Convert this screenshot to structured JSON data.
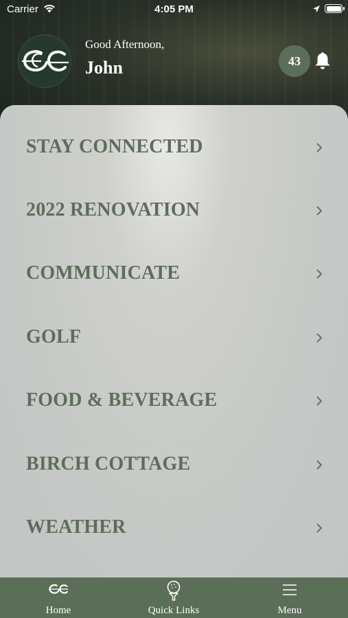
{
  "status_bar": {
    "carrier": "Carrier",
    "time": "4:05 PM"
  },
  "header": {
    "greeting": "Good Afternoon,",
    "user_name": "John",
    "notification_count": "43"
  },
  "menu": {
    "items": [
      {
        "label": "STAY CONNECTED"
      },
      {
        "label": "2022 RENOVATION"
      },
      {
        "label": "COMMUNICATE"
      },
      {
        "label": "GOLF"
      },
      {
        "label": "FOOD & BEVERAGE"
      },
      {
        "label": "BIRCH COTTAGE"
      },
      {
        "label": "WEATHER"
      }
    ]
  },
  "tab_bar": {
    "home": "Home",
    "quick_links": "Quick Links",
    "menu": "Menu"
  },
  "colors": {
    "accent_green": "#5b6e57",
    "menu_text": "#5e6d5b",
    "badge_bg": "#5b6e5a"
  }
}
